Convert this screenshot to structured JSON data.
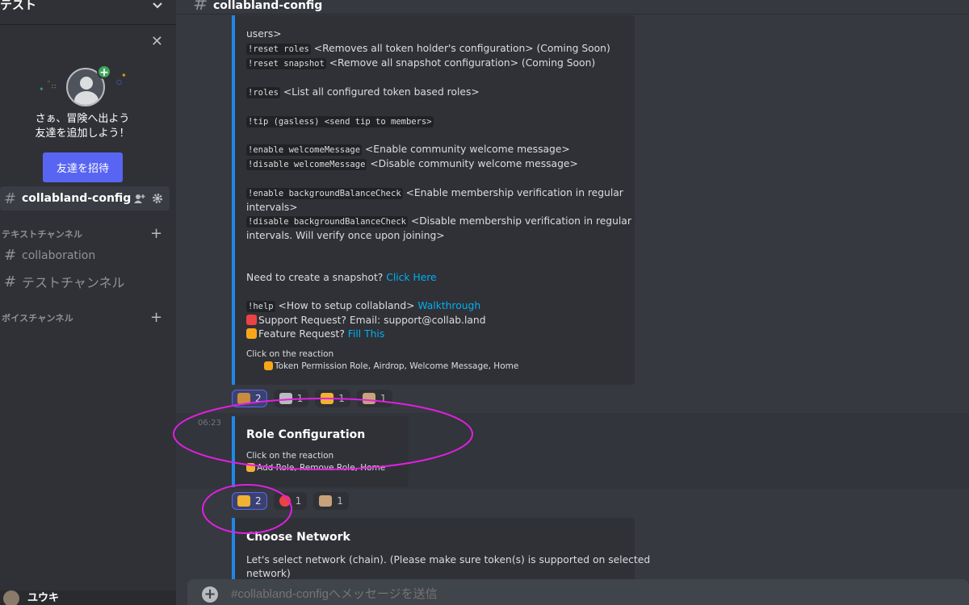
{
  "server": {
    "name": "テスト"
  },
  "invite": {
    "text_line1": "さぁ、冒険へ出よう",
    "text_line2": "友達を追加しよう！",
    "button": "友達を招待"
  },
  "sidebar": {
    "active_channel": "collabland-config",
    "categories": [
      {
        "label": "テキストチャンネル",
        "channels": [
          "collaboration",
          "テストチャンネル"
        ]
      },
      {
        "label": "ボイスチャンネル",
        "channels": []
      }
    ],
    "user": {
      "name": "ユウキ"
    }
  },
  "header": {
    "channel": "collabland-config"
  },
  "embed_main": {
    "line_users": "users>",
    "reset_roles_cmd": "!reset roles",
    "reset_roles_desc": "<Removes all token holder's configuration> (Coming Soon)",
    "reset_snapshot_cmd": "!reset snapshot",
    "reset_snapshot_desc": "<Remove all snapshot configuration> (Coming Soon)",
    "roles_cmd": "!roles",
    "roles_desc": "<List all configured token based roles>",
    "tip_cmd": "!tip (gasless) <send tip to members>",
    "enable_welcome_cmd": "!enable welcomeMessage",
    "enable_welcome_desc": "<Enable community welcome message>",
    "disable_welcome_cmd": "!disable welcomeMessage",
    "disable_welcome_desc": "<Disable community welcome message>",
    "enable_bg_cmd": "!enable backgroundBalanceCheck",
    "enable_bg_desc": "<Enable membership verification in regular",
    "enable_bg_desc2": "intervals>",
    "disable_bg_cmd": "!disable backgroundBalanceCheck",
    "disable_bg_desc": "<Disable membership verification in regular",
    "disable_bg_desc2": "intervals. Will verify once upon joining>",
    "snapshot_text": "Need to create a snapshot?",
    "snapshot_link": "Click Here",
    "help_cmd": "!help",
    "help_desc": "<How to setup collabland>",
    "help_link": "Walkthrough",
    "support_text": "Support Request? Email: support@collab.land",
    "feature_text": "Feature Request?",
    "feature_link": "Fill This",
    "reaction_title": "Click on the reaction",
    "reaction_options": "Token Permission Role,  Airdrop,  Welcome Message, Home"
  },
  "reactions_main": [
    {
      "count": "2"
    },
    {
      "count": "1"
    },
    {
      "count": "1"
    },
    {
      "count": "1"
    }
  ],
  "role_message": {
    "time": "06:23",
    "title": "Role Configuration",
    "sub": "Click on the reaction",
    "options": "Add Role,  Remove Role, Home"
  },
  "reactions_role": [
    {
      "count": "2"
    },
    {
      "count": "1"
    },
    {
      "count": "1"
    }
  ],
  "network_message": {
    "title": "Choose Network",
    "desc": "Let's select network (chain). (Please make sure token(s) is supported on selected",
    "desc2": "network)"
  },
  "composer": {
    "placeholder": "#collabland-configへメッセージを送信"
  },
  "colors": {
    "accent": "#5865f2",
    "embed_border": "#1e88e5",
    "link": "#00aff4",
    "annotation": "#e020e0"
  }
}
